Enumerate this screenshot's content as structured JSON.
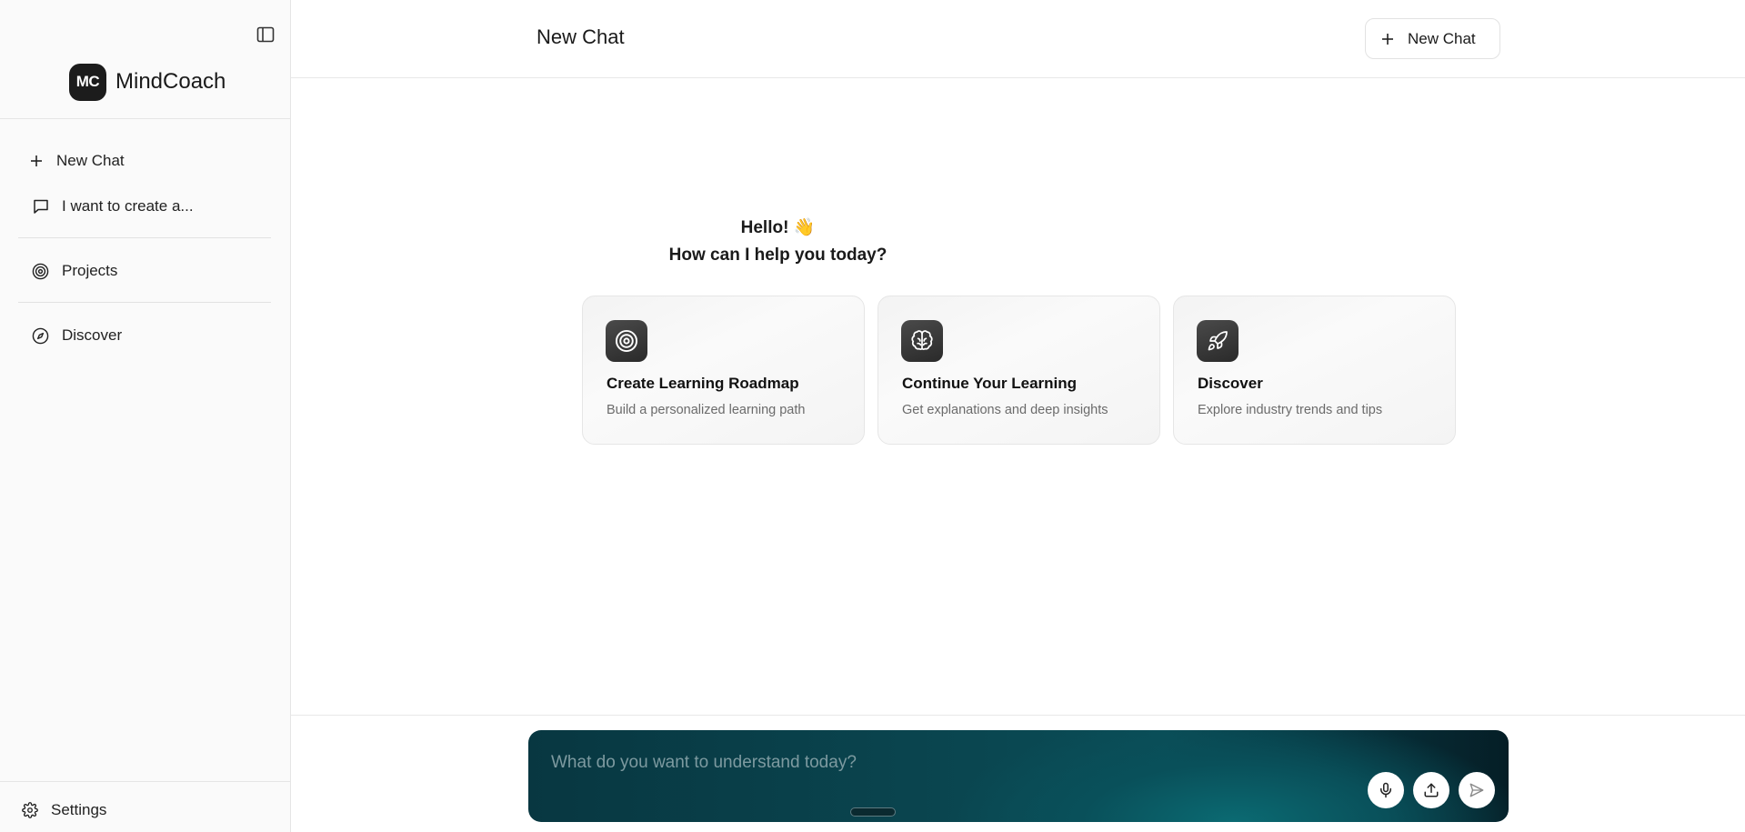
{
  "sidebar": {
    "brand": {
      "logo_text": "MC",
      "name": "MindCoach"
    },
    "items": [
      {
        "label": "New Chat",
        "icon": "plus-icon"
      },
      {
        "label": "I want to create a...",
        "icon": "chat-bubble-icon"
      },
      {
        "label": "Projects",
        "icon": "target-icon"
      },
      {
        "label": "Discover",
        "icon": "compass-icon"
      }
    ],
    "settings_label": "Settings"
  },
  "header": {
    "title": "New Chat",
    "new_chat_label": "New Chat"
  },
  "main": {
    "greeting_line1": "Hello! 👋",
    "greeting_line2": "How can I help you today?",
    "cards": [
      {
        "title": "Create Learning Roadmap",
        "subtitle": "Build a personalized learning path",
        "icon": "target-icon"
      },
      {
        "title": "Continue Your Learning",
        "subtitle": "Get explanations and deep insights",
        "icon": "brain-icon"
      },
      {
        "title": "Discover",
        "subtitle": "Explore industry trends and tips",
        "icon": "rocket-icon"
      }
    ]
  },
  "composer": {
    "placeholder": "What do you want to understand today?",
    "buttons": [
      "microphone-icon",
      "upload-icon",
      "send-icon"
    ]
  },
  "colors": {
    "logo_bg": "#1c1c1c",
    "composer_gradient": [
      "#083741",
      "#0b6a72",
      "#051e26"
    ],
    "sidebar_bg": "#fafafa"
  }
}
